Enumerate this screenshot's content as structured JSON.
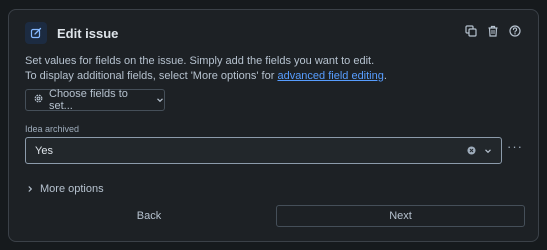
{
  "header": {
    "title": "Edit issue",
    "icons": [
      "edit-icon",
      "duplicate-icon",
      "trash-icon",
      "help-icon"
    ]
  },
  "description": {
    "line1": "Set values for fields on the issue. Simply add the fields you want to edit.",
    "line2_prefix": "To display additional fields, select 'More options' for ",
    "line2_link": "advanced field editing",
    "line2_suffix": "."
  },
  "choose_fields": {
    "label": "Choose fields to set..."
  },
  "field": {
    "label": "Idea archived",
    "value": "Yes"
  },
  "more_actions": "···",
  "more_options": {
    "label": "More options"
  },
  "footer": {
    "back_label": "Back",
    "next_label": "Next"
  },
  "colors": {
    "background": "#161a1d",
    "panel": "#1d2125",
    "link": "#579dff",
    "text": "#b6c2cf"
  }
}
